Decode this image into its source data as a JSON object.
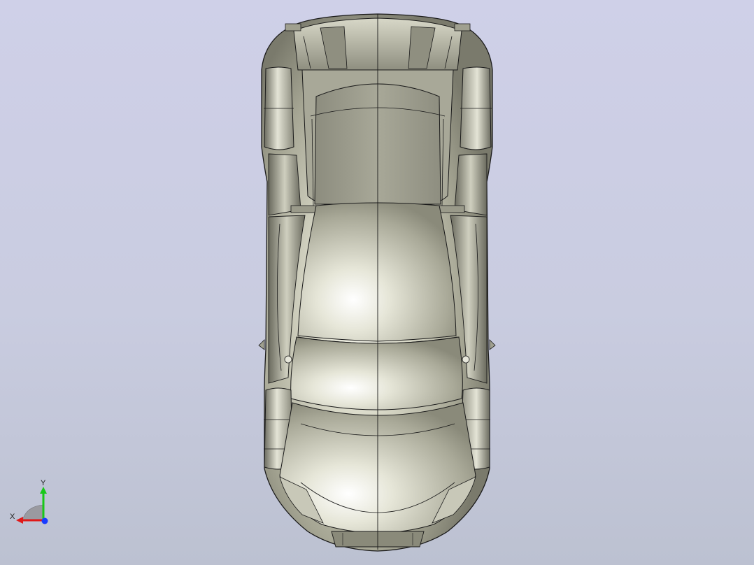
{
  "viewport": {
    "background_top": "#cfd0e8",
    "background_bottom": "#bcc1d1"
  },
  "model": {
    "body_color": "#b9b9a6",
    "highlight_color": "#f4f4ea",
    "shadow_color": "#6e6e62",
    "edge_color": "#1a1a1a"
  },
  "triad": {
    "x_label": "X",
    "y_label": "Y",
    "x_color": "#e01818",
    "y_color": "#18c818",
    "z_color": "#1a3cff"
  }
}
